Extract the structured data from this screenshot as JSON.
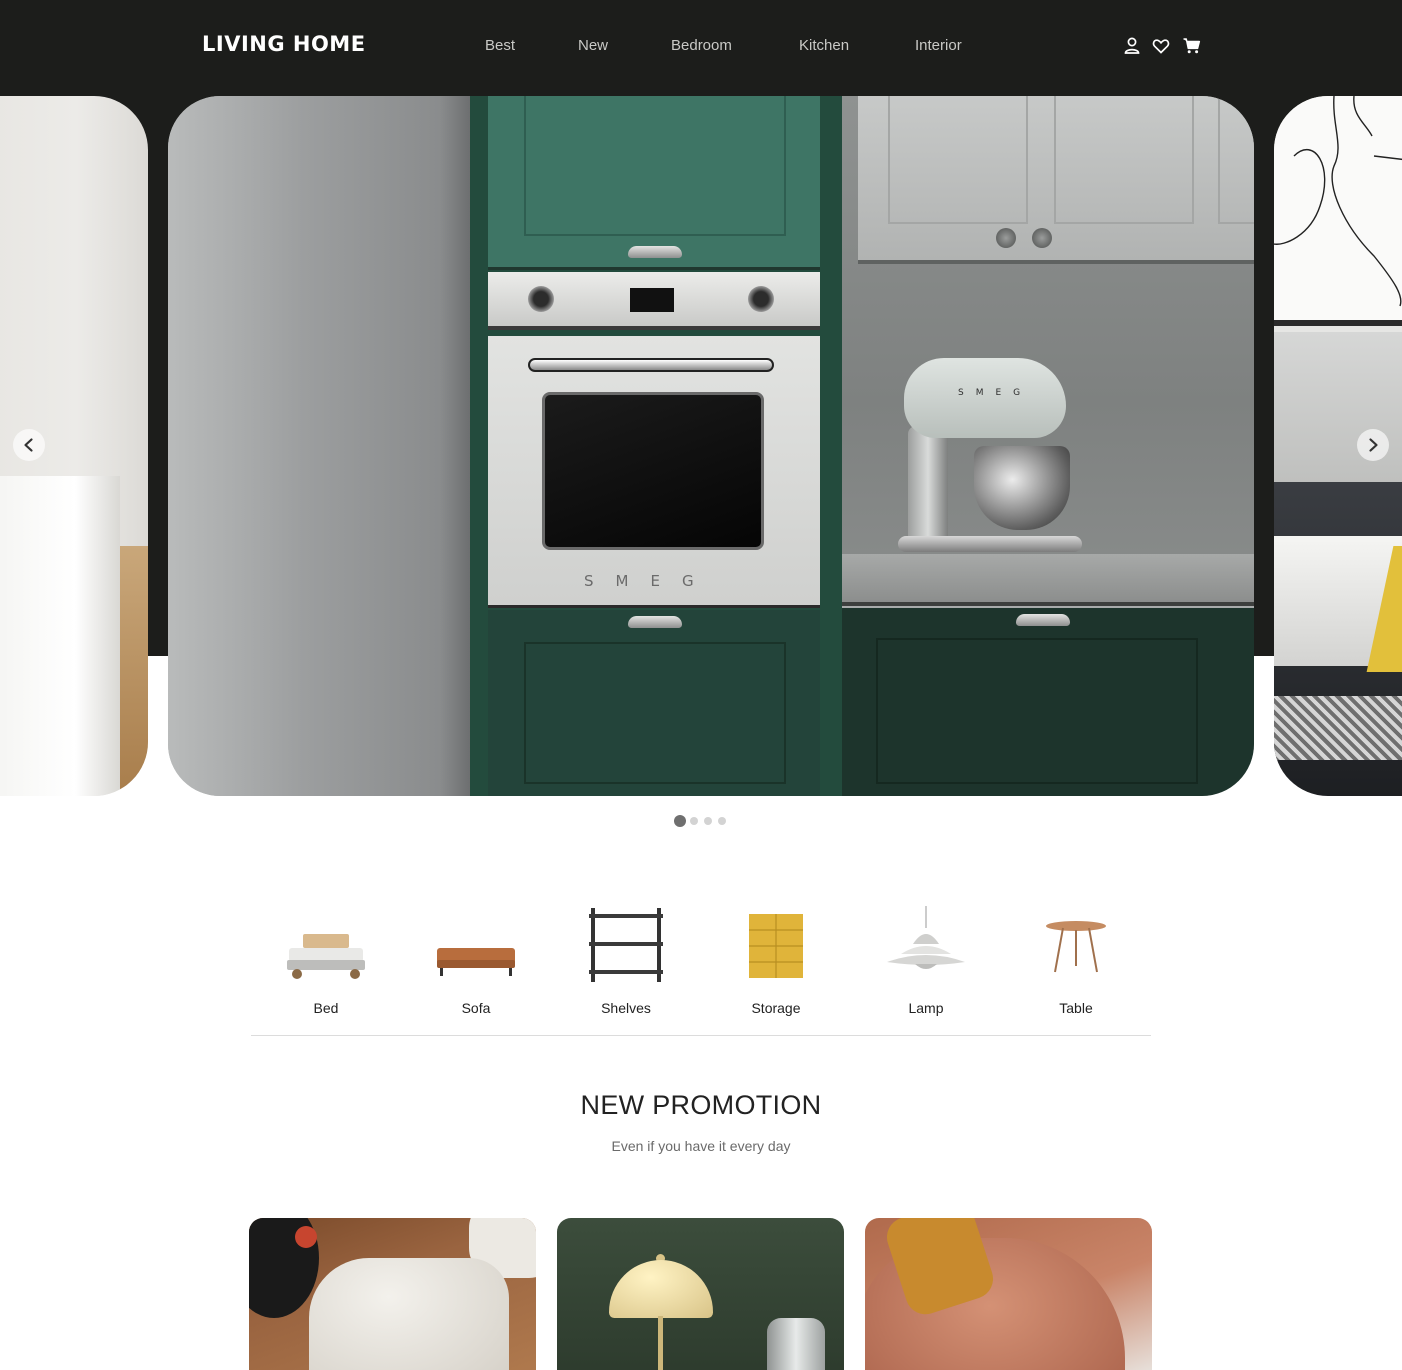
{
  "header": {
    "logo": "LIVING HOME",
    "nav": [
      {
        "label": "Best"
      },
      {
        "label": "New"
      },
      {
        "label": "Bedroom"
      },
      {
        "label": "Kitchen"
      },
      {
        "label": "Interior"
      }
    ],
    "icons": [
      "user-icon",
      "heart-icon",
      "cart-icon"
    ]
  },
  "slider": {
    "current_slide": 1,
    "total_slides": 4,
    "main_slide_brand_oven": "SMEG",
    "main_slide_brand_mixer": "SMEG",
    "prev_icon": "chevron-left-icon",
    "next_icon": "chevron-right-icon"
  },
  "categories": [
    {
      "label": "Bed",
      "icon": "bed-icon"
    },
    {
      "label": "Sofa",
      "icon": "sofa-icon"
    },
    {
      "label": "Shelves",
      "icon": "shelves-icon"
    },
    {
      "label": "Storage",
      "icon": "storage-icon"
    },
    {
      "label": "Lamp",
      "icon": "lamp-icon"
    },
    {
      "label": "Table",
      "icon": "table-icon"
    }
  ],
  "promotion": {
    "title": "NEW PROMOTION",
    "subtitle": "Even if you have it every day"
  },
  "colors": {
    "header_bg": "#1c1d1b",
    "nav_text": "#c9c9c6",
    "kitchen_green": "#234b3d",
    "storage_yellow": "#e0b43a"
  }
}
